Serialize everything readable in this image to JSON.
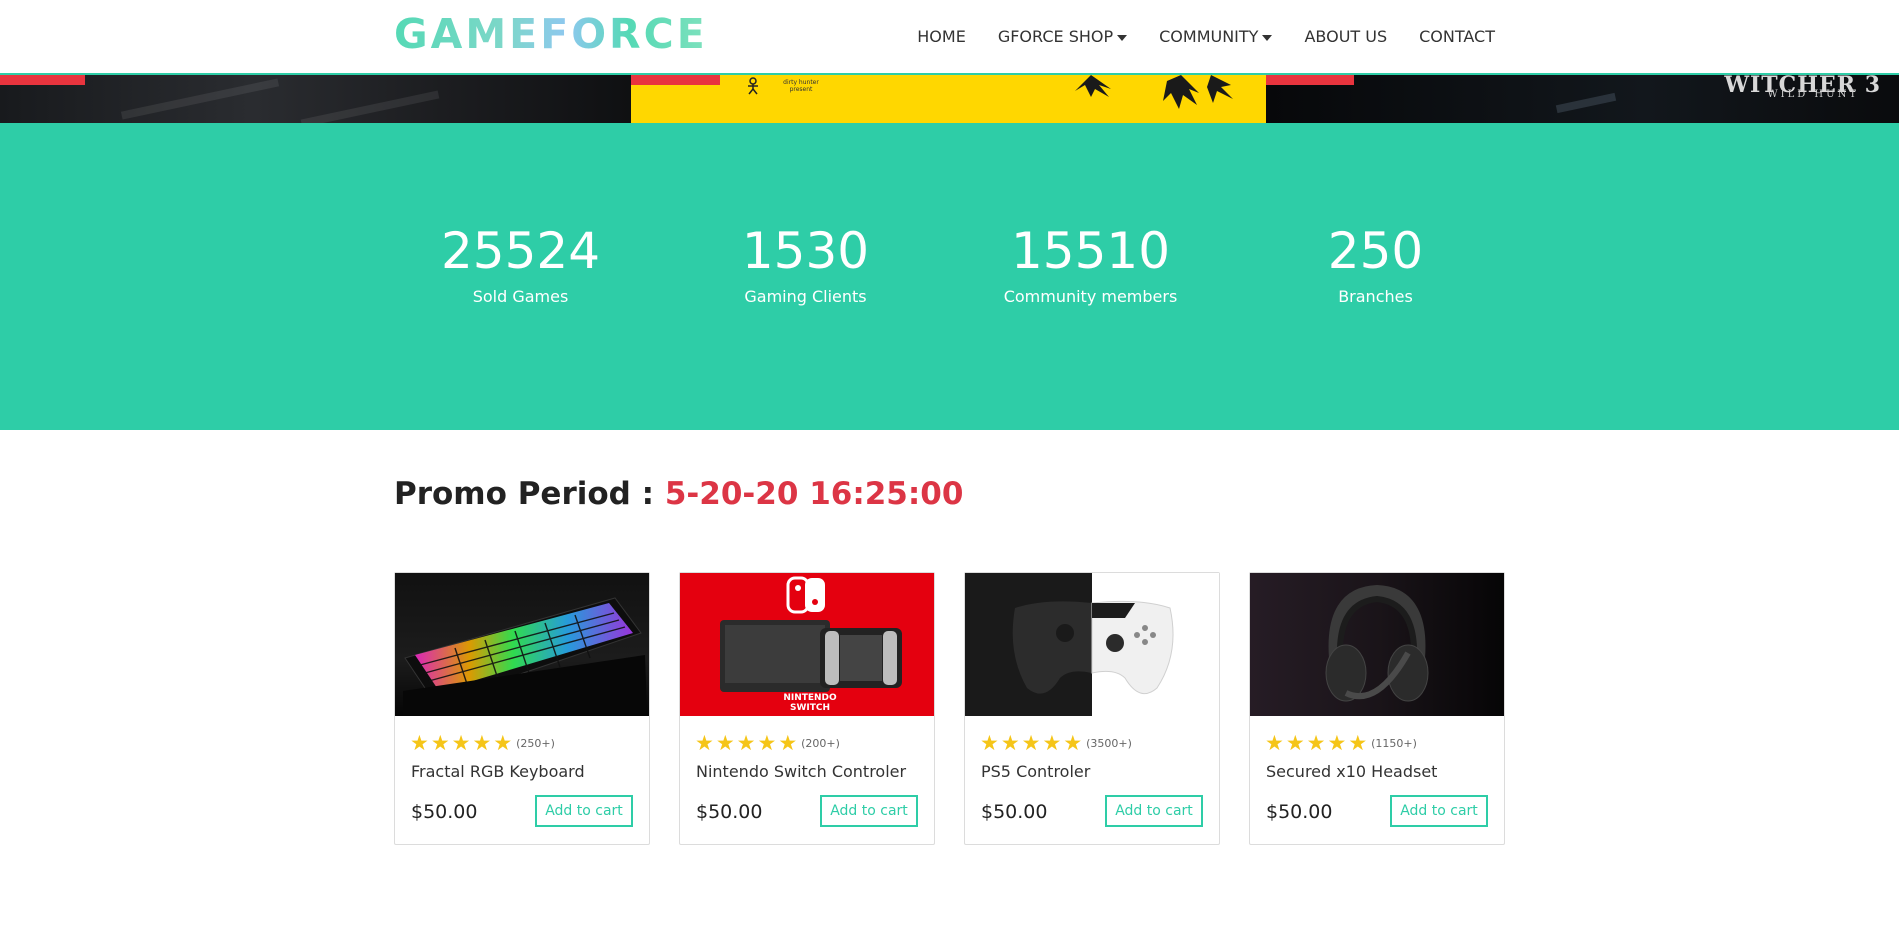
{
  "navbar": {
    "brand": "GAMEFORCE",
    "links": [
      {
        "label": "HOME",
        "dropdown": false
      },
      {
        "label": "GFORCE SHOP",
        "dropdown": true
      },
      {
        "label": "COMMUNITY",
        "dropdown": true
      },
      {
        "label": "ABOUT US",
        "dropdown": false
      },
      {
        "label": "CONTACT",
        "dropdown": false
      }
    ]
  },
  "banner": {
    "panel2_text": "dirty hunter present",
    "panel3_title": "WITCHER 3",
    "panel3_subtitle": "WILD HUNT"
  },
  "stats": [
    {
      "value": "25524",
      "label": "Sold Games"
    },
    {
      "value": "1530",
      "label": "Gaming Clients"
    },
    {
      "value": "15510",
      "label": "Community members"
    },
    {
      "value": "250",
      "label": "Branches"
    }
  ],
  "promo": {
    "label": "Promo Period : ",
    "time": "5-20-20 16:25:00"
  },
  "products": [
    {
      "name": "Fractal RGB Keyboard",
      "rating_count": "(250+)",
      "stars": 5,
      "price": "$50.00",
      "button": "Add to cart",
      "image": "keyboard-image"
    },
    {
      "name": "Nintendo Switch Controler",
      "rating_count": "(200+)",
      "stars": 5,
      "price": "$50.00",
      "button": "Add to cart",
      "image": "switch-image",
      "image_text": "NINTENDO SWITCH"
    },
    {
      "name": "PS5 Controler",
      "rating_count": "(3500+)",
      "stars": 5,
      "price": "$50.00",
      "button": "Add to cart",
      "image": "ps5-controller-image"
    },
    {
      "name": "Secured x10 Headset",
      "rating_count": "(1150+)",
      "stars": 5,
      "price": "$50.00",
      "button": "Add to cart",
      "image": "headset-image"
    }
  ],
  "colors": {
    "accent": "#2ecda7",
    "promo_time": "#dc3545",
    "star": "#f5c518",
    "banner_yellow": "#ffd700",
    "banner_red": "#e8343e"
  }
}
